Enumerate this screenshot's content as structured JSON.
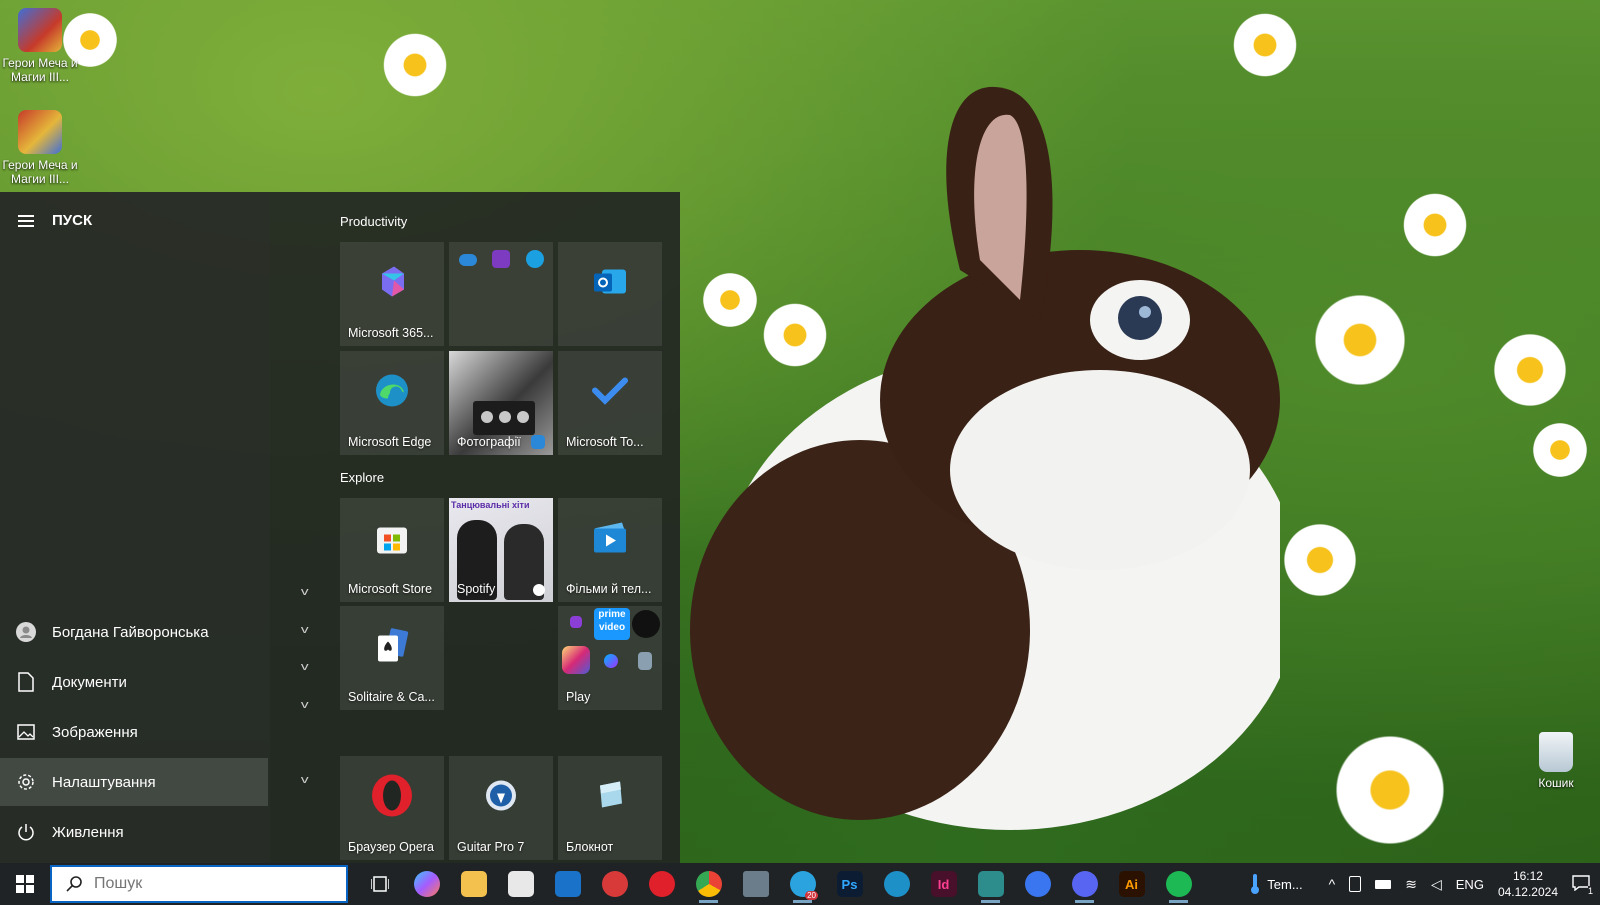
{
  "desktop": {
    "icons": [
      {
        "label": "Герои Меча и Магии III..."
      },
      {
        "label": "Герои Меча и Магии III..."
      },
      {
        "label": "Кошик"
      }
    ]
  },
  "start_menu": {
    "title": "ПУСК",
    "rail_items": [
      {
        "label": "Богдана Гайворонська",
        "icon": "user-icon"
      },
      {
        "label": "Документи",
        "icon": "document-icon"
      },
      {
        "label": "Зображення",
        "icon": "image-icon"
      },
      {
        "label": "Налаштування",
        "icon": "gear-icon",
        "active": true
      },
      {
        "label": "Живлення",
        "icon": "power-icon"
      }
    ],
    "groups": {
      "productivity": "Productivity",
      "explore": "Explore"
    },
    "tiles": {
      "m365": "Microsoft 365...",
      "office_folder": "",
      "outlook": "",
      "edge": "Microsoft Edge",
      "photos": "Фотографії",
      "todo": "Microsoft To...",
      "store": "Microsoft Store",
      "spotify": "Spotify",
      "spotify_banner": "Танцювальні хіти",
      "movies": "Фільми й тел...",
      "solitaire": "Solitaire & Ca...",
      "play": "Play",
      "opera": "Браузер Opera",
      "guitar": "Guitar Pro 7",
      "notepad": "Блокнот",
      "prime_text": "prime video"
    }
  },
  "taskbar": {
    "search_placeholder": "Пошук",
    "weather_text": "Tem...",
    "language": "ENG",
    "time": "16:12",
    "date": "04.12.2024",
    "telegram_badge": "20",
    "notification_count": "1",
    "apps": [
      {
        "name": "task-view",
        "color": "#1f2326"
      },
      {
        "name": "copilot",
        "color": "#5b8def"
      },
      {
        "name": "file-explorer",
        "color": "#f2c14e"
      },
      {
        "name": "microsoft-store",
        "color": "#e8e8e8"
      },
      {
        "name": "outlook",
        "color": "#1a73c8"
      },
      {
        "name": "app-red",
        "color": "#d83a3a"
      },
      {
        "name": "opera",
        "color": "#e0202a"
      },
      {
        "name": "chrome",
        "color": "#34a853"
      },
      {
        "name": "calculator",
        "color": "#6b7d8a"
      },
      {
        "name": "telegram",
        "color": "#2aa3df"
      },
      {
        "name": "photoshop",
        "color": "#0b1c33"
      },
      {
        "name": "edge",
        "color": "#1e90c8"
      },
      {
        "name": "indesign",
        "color": "#48102a"
      },
      {
        "name": "app-teal",
        "color": "#2d8c8c"
      },
      {
        "name": "signal",
        "color": "#3a76f0"
      },
      {
        "name": "discord",
        "color": "#5865f2"
      },
      {
        "name": "illustrator",
        "color": "#2b1100"
      },
      {
        "name": "spotify",
        "color": "#1db954"
      }
    ]
  },
  "colors": {
    "accent": "#0a64c2",
    "start_bg": "#22261f",
    "taskbar_bg": "#1f2326"
  }
}
